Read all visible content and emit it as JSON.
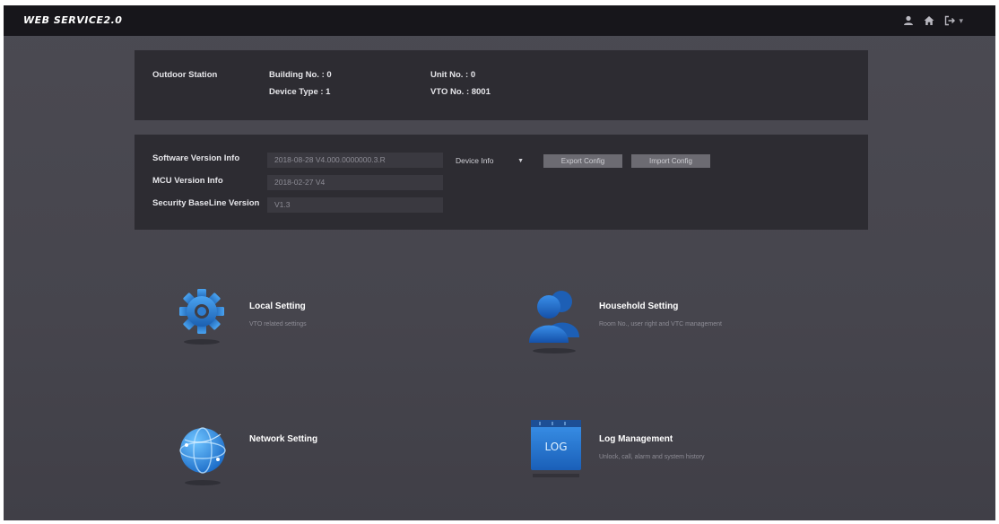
{
  "app": {
    "title": "WEB SERVICE2.0"
  },
  "header_icons": [
    "user-icon",
    "home-icon",
    "logout-icon"
  ],
  "station": {
    "type_label": "Outdoor Station",
    "building_no": "Building No. : 0",
    "device_type": "Device Type : 1",
    "unit_no": "Unit No. : 0",
    "vto_no": "VTO No. : 8001"
  },
  "version": {
    "software_label": "Software Version Info",
    "software_value": "2018-08-28 V4.000.0000000.3.R",
    "mcu_label": "MCU Version Info",
    "mcu_value": "2018-02-27 V4",
    "security_label": "Security BaseLine Version",
    "security_value": "V1.3",
    "dropdown_value": "Device Info",
    "export_label": "Export Config",
    "import_label": "Import Config"
  },
  "tiles": {
    "local": {
      "title": "Local Setting",
      "desc": "VTO related settings",
      "icon": "gear-icon"
    },
    "household": {
      "title": "Household Setting",
      "desc": "Room No., user right and VTC management",
      "icon": "users-icon"
    },
    "network": {
      "title": "Network Setting",
      "desc": "",
      "icon": "globe-icon"
    },
    "log": {
      "title": "Log Management",
      "desc": "Unlock, call, alarm and system history",
      "icon": "log-icon",
      "icon_text": "LOG"
    }
  },
  "colors": {
    "topbar": "#17161b",
    "background": "#47464e",
    "panel": "#2d2c32",
    "accent_blue": "#1e7fd6"
  }
}
